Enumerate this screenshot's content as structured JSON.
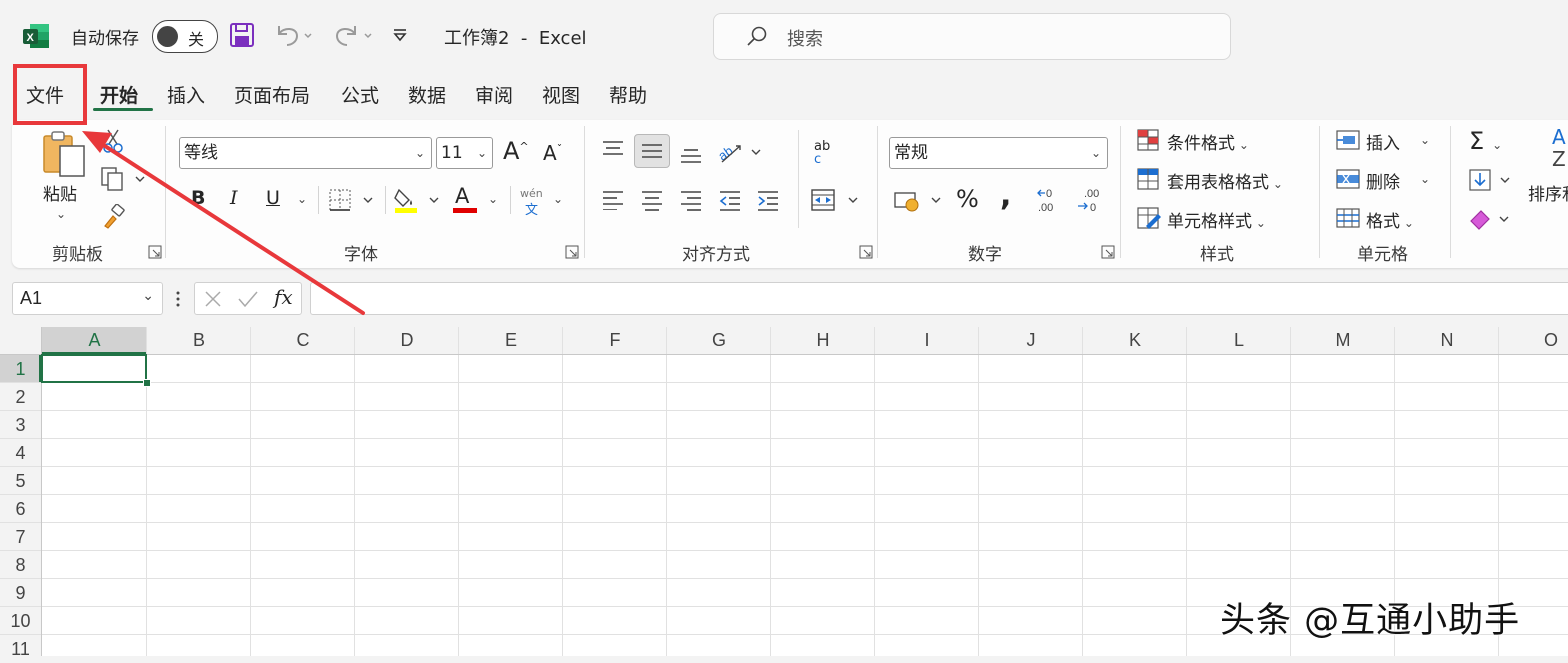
{
  "titlebar": {
    "autosave_label": "自动保存",
    "autosave_state": "关",
    "document_title": "工作簿2  -  Excel"
  },
  "search": {
    "placeholder": "搜索"
  },
  "tabs": [
    {
      "label": "文件",
      "highlighted": true
    },
    {
      "label": "开始",
      "active": true
    },
    {
      "label": "插入"
    },
    {
      "label": "页面布局"
    },
    {
      "label": "公式"
    },
    {
      "label": "数据"
    },
    {
      "label": "审阅"
    },
    {
      "label": "视图"
    },
    {
      "label": "帮助"
    }
  ],
  "ribbon": {
    "clipboard": {
      "label": "剪贴板",
      "paste_label": "粘贴"
    },
    "font": {
      "label": "字体",
      "font_name": "等线",
      "font_size": "11",
      "bold": "B",
      "italic": "I",
      "underline": "U",
      "font_color_letter": "A",
      "phonetic_top": "wén",
      "phonetic_bottom": "文",
      "grow_letter": "A",
      "shrink_letter": "A"
    },
    "alignment": {
      "label": "对齐方式",
      "wrap_top": "ab",
      "wrap_bottom": "c"
    },
    "number": {
      "label": "数字",
      "format": "常规",
      "percent": "%",
      "comma": ","
    },
    "styles": {
      "label": "样式",
      "conditional": "条件格式",
      "table_format": "套用表格格式",
      "cell_styles": "单元格样式"
    },
    "cells": {
      "label": "单元格",
      "insert": "插入",
      "delete": "删除",
      "format": "格式"
    },
    "editing": {
      "sort_label": "排序和",
      "sort_top": "A",
      "sort_bottom": "Z",
      "sum_symbol": "Σ"
    }
  },
  "formula_bar": {
    "name_box": "A1",
    "fx": "fx"
  },
  "grid": {
    "columns": [
      "A",
      "B",
      "C",
      "D",
      "E",
      "F",
      "G",
      "H",
      "I",
      "J",
      "K",
      "L",
      "M",
      "N",
      "O"
    ],
    "rows": [
      "1",
      "2",
      "3",
      "4",
      "5",
      "6",
      "7",
      "8",
      "9",
      "10",
      "11"
    ],
    "selected_cell": "A1"
  },
  "annotation": {
    "highlight_color": "#e8383b"
  },
  "watermark": "头条 @互通小助手",
  "colors": {
    "excel_green": "#217346",
    "active_tab_underline": "#217346",
    "save_icon": "#8a2be2"
  }
}
